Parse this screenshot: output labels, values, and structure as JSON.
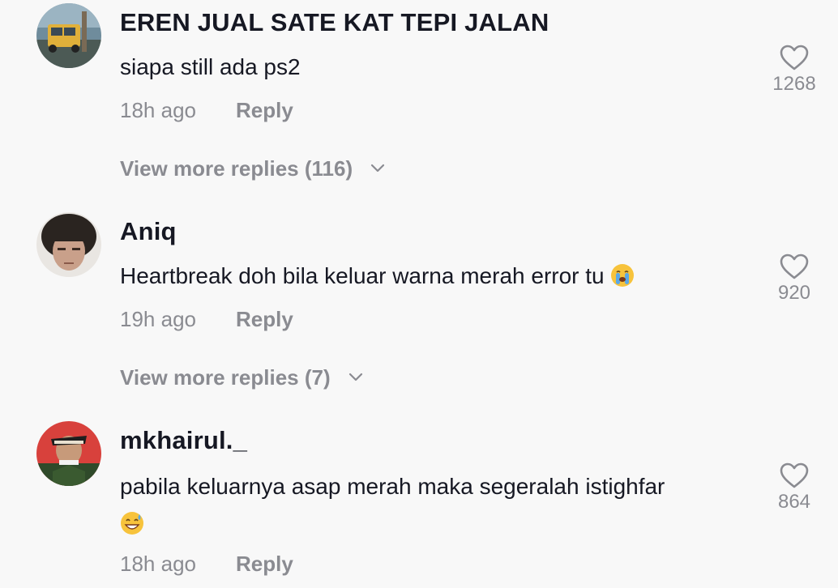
{
  "comments": [
    {
      "username": "EREN JUAL SATE KAT TEPI JALAN",
      "text": "siapa still ada ps2",
      "emoji": "",
      "time": "18h ago",
      "reply_label": "Reply",
      "likes": "1268",
      "view_more": "View more replies (116)"
    },
    {
      "username": "Aniq",
      "text": "Heartbreak doh bila keluar warna merah error tu",
      "emoji": "loudly-crying-face-emoji",
      "time": "19h ago",
      "reply_label": "Reply",
      "likes": "920",
      "view_more": "View more replies (7)"
    },
    {
      "username": "mkhairul._",
      "text": "pabila keluarnya asap merah maka segeralah istighfar",
      "emoji": "grinning-face-with-sweat-emoji",
      "time": "18h ago",
      "reply_label": "Reply",
      "likes": "864",
      "view_more": ""
    }
  ],
  "icons": {
    "like": "heart-outline-icon",
    "expand": "chevron-down-icon"
  },
  "colors": {
    "background": "#f8f8f8",
    "primary_text": "#161823",
    "secondary_text": "#8a8b91"
  }
}
